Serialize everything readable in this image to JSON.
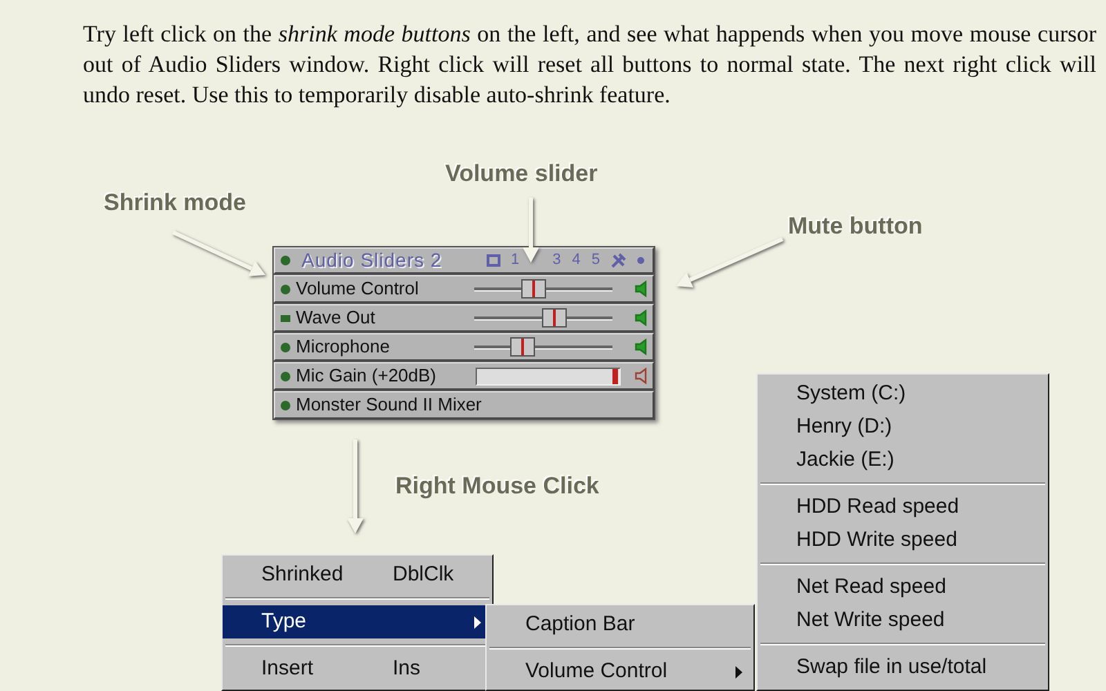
{
  "intro": "Try left click on the  *shrink mode buttons*  on the left, and see what happends when  you move mouse cursor out of Audio Sliders window. Right click will reset all buttons to  normal state. The next right click will undo reset. Use this to temporarily disable auto-shrink feature.",
  "callouts": [
    {
      "label": "Shrink mode"
    },
    {
      "label": "Volume slider"
    },
    {
      "label": "Mute button"
    },
    {
      "label": "Right Mouse Click"
    }
  ],
  "audio_sliders": {
    "title": "Audio Sliders 2",
    "page_buttons": [
      "1",
      "3",
      "4",
      "5"
    ],
    "rows": [
      {
        "name": "Volume Control",
        "kind": "slider",
        "shrink": false,
        "level": 0.42,
        "muted": false
      },
      {
        "name": "Wave Out",
        "kind": "slider",
        "shrink": true,
        "level": 0.6,
        "muted": false
      },
      {
        "name": "Microphone",
        "kind": "slider",
        "shrink": false,
        "level": 0.32,
        "muted": false
      },
      {
        "name": "Mic Gain (+20dB)",
        "kind": "gauge",
        "shrink": false,
        "level": 1,
        "muted": true
      },
      {
        "name": "Monster Sound II Mixer",
        "kind": "label",
        "shrink": false
      }
    ]
  },
  "context_menu": [
    {
      "kind": "item",
      "label": "Shrinked",
      "shortcut": "DblClk",
      "submenu": false,
      "selected": false
    },
    {
      "kind": "separator"
    },
    {
      "kind": "item",
      "label": "Type",
      "submenu": true,
      "selected": true
    },
    {
      "kind": "separator"
    },
    {
      "kind": "item",
      "label": "Insert",
      "shortcut": "Ins",
      "submenu": false,
      "selected": false
    }
  ],
  "type_submenu": [
    {
      "kind": "item",
      "label": "Caption Bar",
      "submenu": false,
      "selected": false
    },
    {
      "kind": "separator"
    },
    {
      "kind": "item",
      "label": "Volume Control",
      "submenu": true,
      "selected": false
    }
  ],
  "system_menu": [
    {
      "kind": "item",
      "label": "System (C:)",
      "submenu": false,
      "selected": false
    },
    {
      "kind": "item",
      "label": "Henry (D:)",
      "submenu": false,
      "selected": false
    },
    {
      "kind": "item",
      "label": "Jackie (E:)",
      "submenu": false,
      "selected": false
    },
    {
      "kind": "separator"
    },
    {
      "kind": "item",
      "label": "HDD Read speed",
      "submenu": false,
      "selected": false
    },
    {
      "kind": "item",
      "label": "HDD Write speed",
      "submenu": false,
      "selected": false
    },
    {
      "kind": "separator"
    },
    {
      "kind": "item",
      "label": "Net Read speed",
      "submenu": false,
      "selected": false
    },
    {
      "kind": "item",
      "label": "Net Write speed",
      "submenu": false,
      "selected": false
    },
    {
      "kind": "separator"
    },
    {
      "kind": "item",
      "label": "Swap file in use/total",
      "submenu": false,
      "selected": false
    }
  ]
}
